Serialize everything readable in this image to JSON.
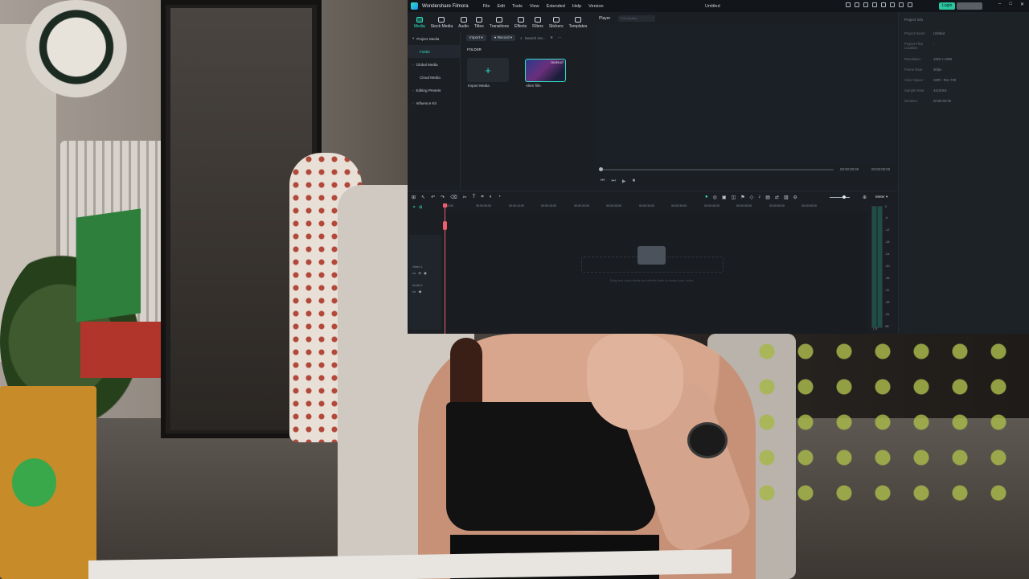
{
  "app": {
    "name": "Wondershare Filmora",
    "doc_title": "Untitled",
    "login_label": "Login",
    "menus": [
      "File",
      "Edit",
      "Tools",
      "View",
      "Extended",
      "Help",
      "Version"
    ],
    "accent": "#2fe3c2"
  },
  "media_tabs": [
    {
      "label": "Media",
      "icon": "media-icon",
      "active": true
    },
    {
      "label": "Stock Media",
      "icon": "stock-media-icon",
      "active": false
    },
    {
      "label": "Audio",
      "icon": "audio-icon",
      "active": false
    },
    {
      "label": "Titles",
      "icon": "titles-icon",
      "active": false
    },
    {
      "label": "Transitions",
      "icon": "transitions-icon",
      "active": false
    },
    {
      "label": "Effects",
      "icon": "effects-icon",
      "active": false
    },
    {
      "label": "Filters",
      "icon": "filters-icon",
      "active": false
    },
    {
      "label": "Stickers",
      "icon": "stickers-icon",
      "active": false
    },
    {
      "label": "Templates",
      "icon": "templates-icon",
      "active": false
    }
  ],
  "sidebar": {
    "project_media": "Project Media",
    "folder": "Folder",
    "global_media": "Global Media",
    "cloud_media": "Cloud Media",
    "editing_presets": "Editing Presets",
    "influence_kit": "Influence Kit"
  },
  "media_panel": {
    "import_label": "Import",
    "record_label": "Record",
    "search_placeholder": "Search me...",
    "folder_title": "FOLDER",
    "import_media_label": "Import Media",
    "clip_name": "Alien film",
    "clip_duration": "00:59:47"
  },
  "player": {
    "label": "Player",
    "quality": "Full Quality"
  },
  "info": {
    "title": "Project Info",
    "rows": [
      {
        "k": "Project Name:",
        "v": "Untitled"
      },
      {
        "k": "Project Files Location:",
        "v": "-"
      },
      {
        "k": "Resolution:",
        "v": "1920 x 1080"
      },
      {
        "k": "Frame Rate:",
        "v": "30fps"
      },
      {
        "k": "Color Space:",
        "v": "SDR - Rec.709"
      },
      {
        "k": "Sample Rate:",
        "v": "44100Hz"
      },
      {
        "k": "Duration:",
        "v": "00:00:00:00"
      }
    ]
  },
  "timeline": {
    "meter_label": "Meter",
    "ticks": [
      "00:00",
      "00:00:05:00",
      "00:00:10:00",
      "00:00:15:00",
      "00:00:20:00",
      "00:00:25:00",
      "00:00:30:00",
      "00:00:35:00",
      "00:00:40:00",
      "00:00:45:00",
      "00:00:50:00",
      "00:00:55:00"
    ],
    "track_video": "Video 1",
    "track_audio": "Audio 1",
    "drop_text": "Drag and drop media and effects here to create your video.",
    "meter_scale": [
      "0",
      "-6",
      "-12",
      "-18",
      "-24",
      "-30",
      "-36",
      "-42",
      "-48",
      "-54",
      "dB"
    ],
    "lr": "L   R"
  }
}
